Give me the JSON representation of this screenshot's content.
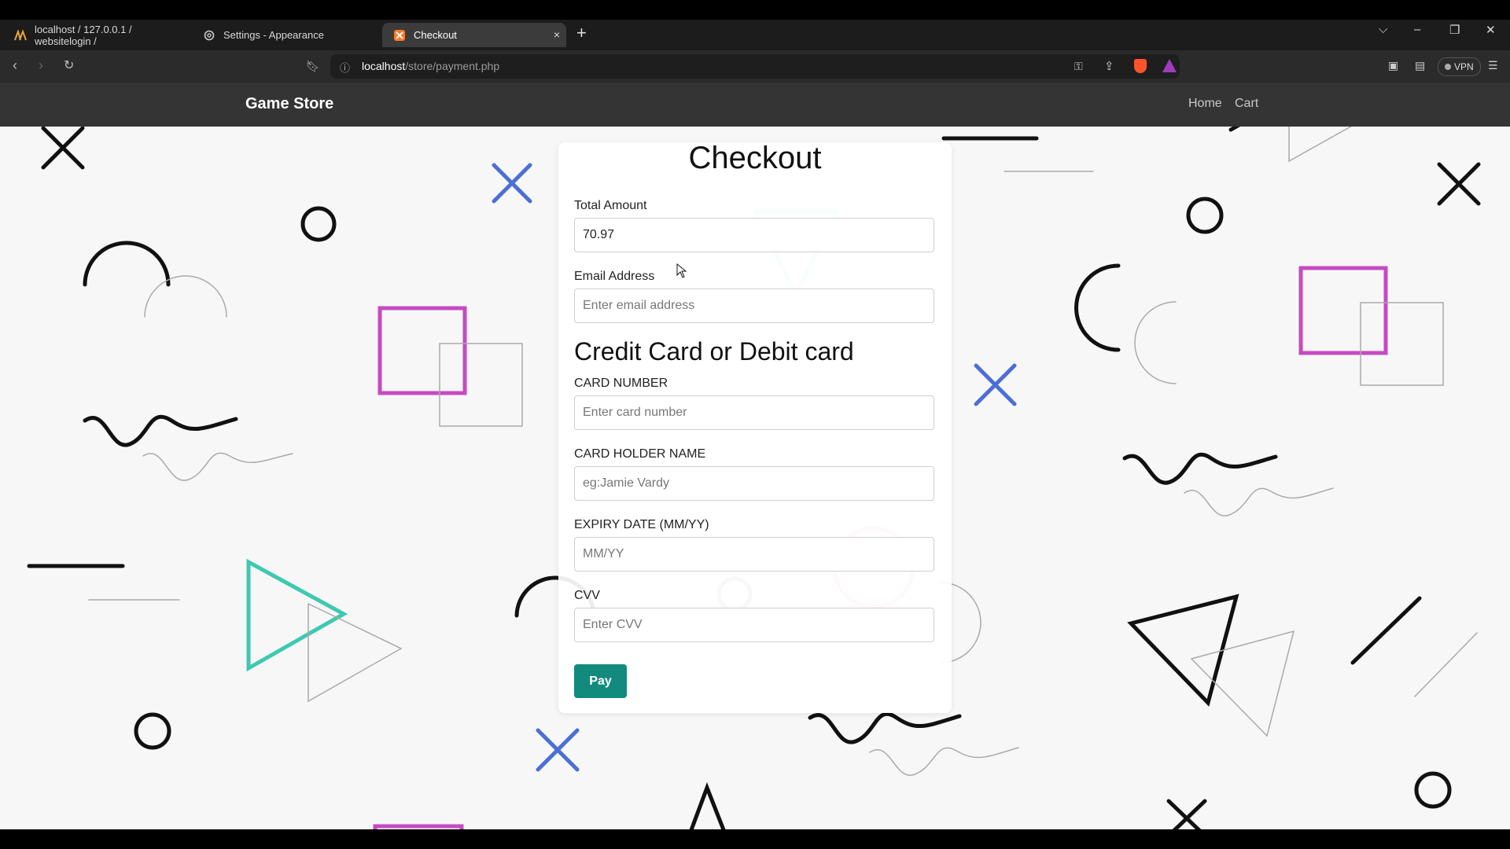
{
  "browser": {
    "tabs": [
      {
        "label": "localhost / 127.0.0.1 / websitelogin /",
        "icon": "phpmyadmin-icon"
      },
      {
        "label": "Settings - Appearance",
        "icon": "gear-icon"
      },
      {
        "label": "Checkout",
        "icon": "xampp-icon"
      }
    ],
    "url_host": "localhost",
    "url_path": "/store/payment.php",
    "vpn_label": "VPN",
    "new_tab": "+",
    "close_tab": "×"
  },
  "site": {
    "brand": "Game Store",
    "nav": {
      "home": "Home",
      "cart": "Cart"
    }
  },
  "form": {
    "title": "Checkout",
    "total_label": "Total Amount",
    "total_value": "70.97",
    "email_label": "Email Address",
    "email_placeholder": "Enter email address",
    "section_title": "Credit Card or Debit card",
    "card_number_label": "CARD NUMBER",
    "card_number_placeholder": "Enter card number",
    "holder_label": "CARD HOLDER NAME",
    "holder_placeholder": "eg:Jamie Vardy",
    "expiry_label": "EXPIRY DATE (MM/YY)",
    "expiry_placeholder": "MM/YY",
    "cvv_label": "CVV",
    "cvv_placeholder": "Enter CVV",
    "pay_button": "Pay"
  },
  "colors": {
    "pay": "#138a7e",
    "accent_pink": "#c54bc1",
    "accent_teal": "#3ec9b1",
    "accent_blue": "#4a6fd6"
  }
}
